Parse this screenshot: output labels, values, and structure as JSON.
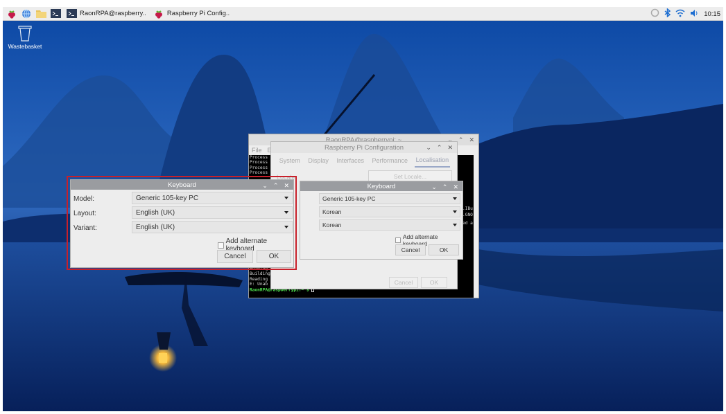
{
  "taskbar": {
    "tasks": [
      {
        "label": "RaonRPA@raspberry..",
        "icon": "terminal-icon"
      },
      {
        "label": "Raspberry Pi Config..",
        "icon": "raspberry-icon"
      }
    ],
    "clock": "10:15"
  },
  "desktop": {
    "trash_label": "Wastebasket"
  },
  "terminal": {
    "title": "RaonRPA@raspberrypi: ~",
    "menu": [
      "File",
      "E"
    ],
    "lines": [
      "Process",
      "Process",
      "Process",
      "Process"
    ],
    "bottom_lines": [
      "Reading",
      "Building",
      "Reading",
      "E: Unab"
    ],
    "prompt_user": "RaonRPA@raspberrypi",
    "prompt_rest": ":~ $",
    "right_fragments": [
      ".IBu",
      ".GNO",
      "ed a"
    ]
  },
  "config": {
    "title": "Raspberry Pi Configuration",
    "tabs": [
      "System",
      "Display",
      "Interfaces",
      "Performance",
      "Localisation"
    ],
    "active_tab": "Localisation",
    "locale_label": "Locale:",
    "set_locale_button": "Set Locale...",
    "cancel_button": "Cancel",
    "ok_button": "OK"
  },
  "keyboard_back": {
    "title": "Keyboard",
    "model": "Generic 105-key PC",
    "layout": "Korean",
    "variant": "Korean",
    "alternate_label": "Add alternate keyboard",
    "cancel_button": "Cancel",
    "ok_button": "OK"
  },
  "keyboard_front": {
    "title": "Keyboard",
    "model_label": "Model:",
    "layout_label": "Layout:",
    "variant_label": "Variant:",
    "model": "Generic 105-key PC",
    "layout": "English (UK)",
    "variant": "English (UK)",
    "alternate_label": "Add alternate keyboard",
    "cancel_button": "Cancel",
    "ok_button": "OK"
  },
  "colors": {
    "highlight_frame": "#c8202a",
    "prompt_green": "#4ee04e",
    "sky_top": "#0b3d98",
    "water": "#0a2f78"
  }
}
